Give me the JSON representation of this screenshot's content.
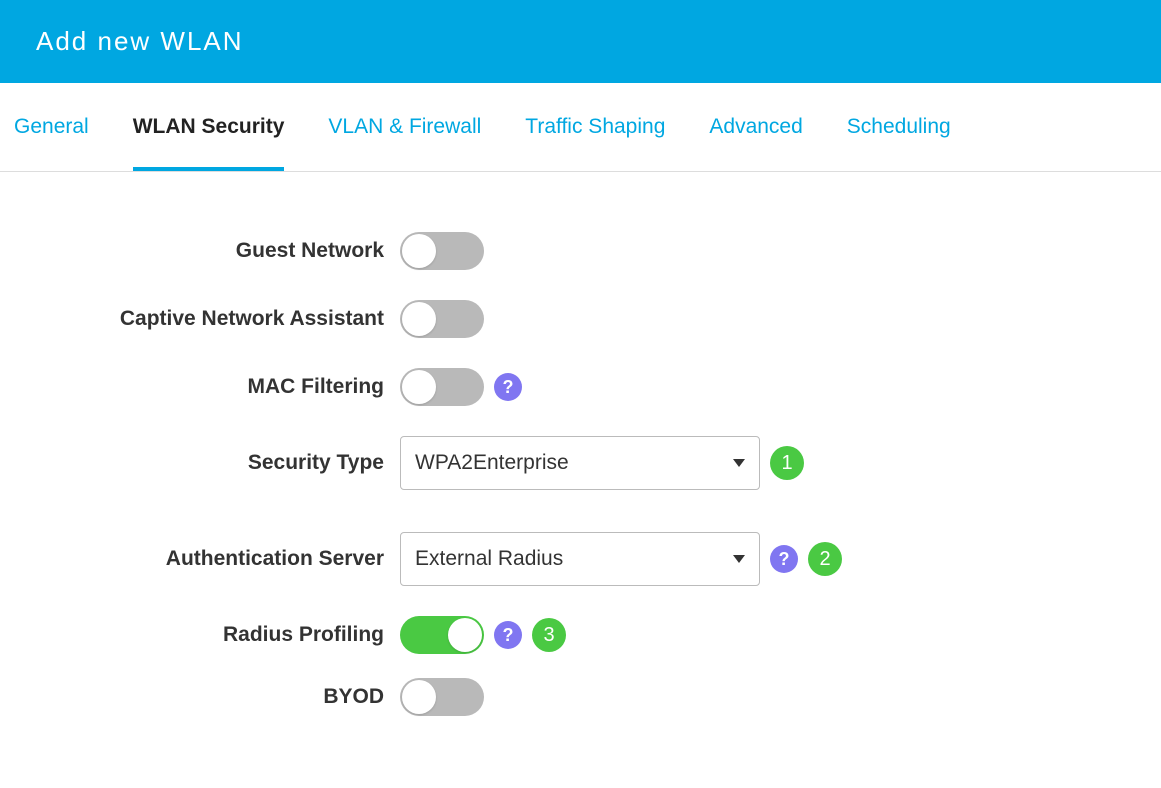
{
  "header": {
    "title": "Add new WLAN"
  },
  "tabs": [
    {
      "label": "General",
      "active": false
    },
    {
      "label": "WLAN Security",
      "active": true
    },
    {
      "label": "VLAN & Firewall",
      "active": false
    },
    {
      "label": "Traffic Shaping",
      "active": false
    },
    {
      "label": "Advanced",
      "active": false
    },
    {
      "label": "Scheduling",
      "active": false
    }
  ],
  "form": {
    "guest_network": {
      "label": "Guest Network",
      "value": false
    },
    "captive_network_assistant": {
      "label": "Captive Network Assistant",
      "value": false
    },
    "mac_filtering": {
      "label": "MAC Filtering",
      "value": false,
      "help": true
    },
    "security_type": {
      "label": "Security Type",
      "value": "WPA2Enterprise",
      "badge": "1"
    },
    "authentication_server": {
      "label": "Authentication Server",
      "value": "External Radius",
      "help": true,
      "badge": "2"
    },
    "radius_profiling": {
      "label": "Radius Profiling",
      "value": true,
      "help": true,
      "badge": "3"
    },
    "byod": {
      "label": "BYOD",
      "value": false
    }
  },
  "icons": {
    "help_glyph": "?"
  }
}
